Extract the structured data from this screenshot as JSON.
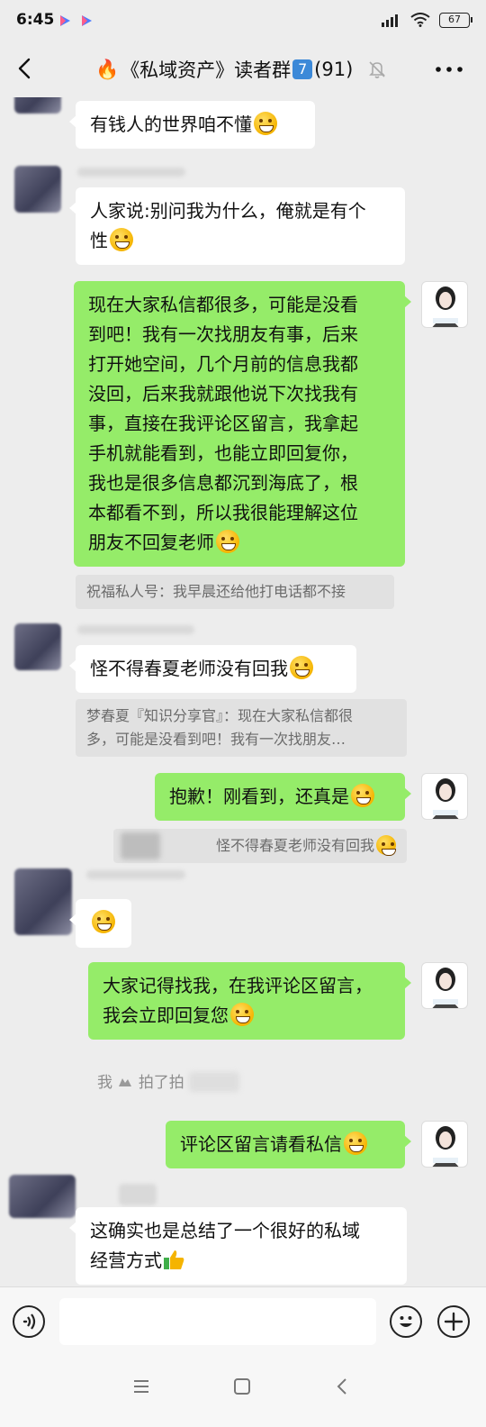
{
  "status": {
    "time": "6:45",
    "battery": "67"
  },
  "header": {
    "flame": "🔥",
    "title_pre": "《私域资产》读者群",
    "group_num": "7",
    "member_count": "(91)"
  },
  "messages": {
    "m1": "有钱人的世界咱不懂",
    "m2_line1": "人家说:别问我为什么，俺就是有个",
    "m2_line2": "性",
    "m3_lines": [
      "现在大家私信都很多，可能是没看",
      "到吧！我有一次找朋友有事，后来",
      "打开她空间，几个月前的信息我都",
      "没回，后来我就跟他说下次找我有",
      "事，直接在我评论区留言，我拿起",
      "手机就能看到，也能立即回复你，",
      "我也是很多信息都沉到海底了，根",
      "本都看不到，所以我很能理解这位",
      "朋友不回复老师"
    ],
    "q1": "祝福私人号：我早晨还给他打电话都不接",
    "m4": "怪不得春夏老师没有回我",
    "q2_line1": "梦春夏『知识分享官』：现在大家私信都很",
    "q2_line2": "多，可能是没看到吧！我有一次找朋友…",
    "m5": "抱歉！刚看到，还真是",
    "q3": "怪不得春夏老师没有回我",
    "m7_line1": "大家记得找我，在我评论区留言，",
    "m7_line2": "我会立即回复您",
    "sys_pre": "我",
    "sys_post": "拍了拍",
    "m8": "评论区留言请看私信",
    "m9_line1": "这确实也是总结了一个很好的私域",
    "m9_line2": "经营方式"
  },
  "input": {
    "placeholder": ""
  },
  "colors": {
    "sent_bubble": "#95ec69",
    "received_bubble": "#ffffff",
    "background": "#ededed",
    "badge": "#3c89d8"
  },
  "icons": [
    "back-icon",
    "mute-bell-icon",
    "more-icon",
    "voice-icon",
    "emoji-icon",
    "plus-icon",
    "menu-icon",
    "home-icon",
    "nav-back-icon"
  ]
}
